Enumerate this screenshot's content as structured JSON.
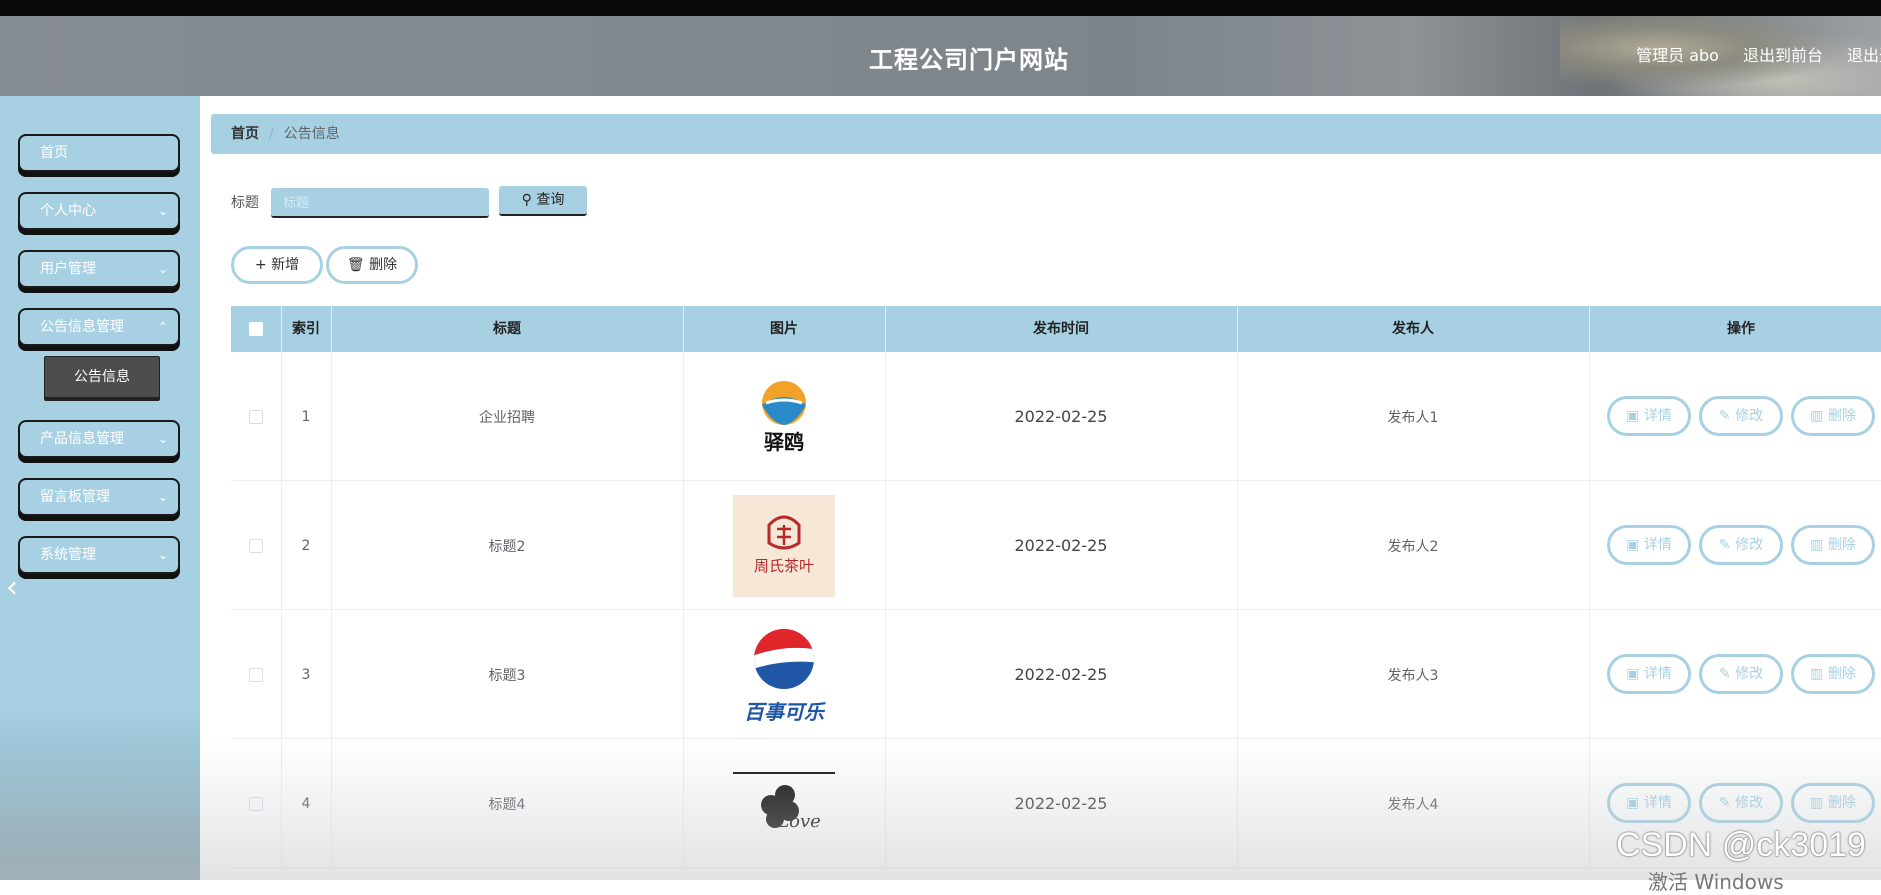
{
  "header": {
    "site_title": "工程公司门户网站",
    "admin_label": "管理员 abo",
    "back_front": "退出到前台",
    "logout": "退出登录"
  },
  "sidebar": {
    "items": [
      {
        "label": "首页",
        "has_children": false
      },
      {
        "label": "个人中心",
        "has_children": true
      },
      {
        "label": "用户管理",
        "has_children": true
      },
      {
        "label": "公告信息管理",
        "has_children": true
      },
      {
        "label": "产品信息管理",
        "has_children": true
      },
      {
        "label": "留言板管理",
        "has_children": true
      },
      {
        "label": "系统管理",
        "has_children": true
      }
    ],
    "active_sub": "公告信息"
  },
  "breadcrumb": {
    "home": "首页",
    "separator": "/",
    "current": "公告信息"
  },
  "search": {
    "label": "标题",
    "placeholder": "标题",
    "button": "查询"
  },
  "actions": {
    "add": "新增",
    "delete": "删除"
  },
  "table": {
    "headers": [
      "索引",
      "标题",
      "图片",
      "发布时间",
      "发布人",
      "操作"
    ],
    "rows": [
      {
        "index": "1",
        "title": "企业招聘",
        "logo_text": "驿鸥",
        "date": "2022-02-25",
        "publisher": "发布人1"
      },
      {
        "index": "2",
        "title": "标题2",
        "logo_text": "周氏茶叶",
        "date": "2022-02-25",
        "publisher": "发布人2"
      },
      {
        "index": "3",
        "title": "标题3",
        "logo_text": "百事可乐",
        "date": "2022-02-25",
        "publisher": "发布人3"
      },
      {
        "index": "4",
        "title": "标题4",
        "logo_text": "Love",
        "date": "2022-02-25",
        "publisher": "发布人4"
      }
    ],
    "row_ops": {
      "detail": "详情",
      "edit": "修改",
      "delete": "删除"
    }
  },
  "watermark": "CSDN @ck3019",
  "windows_activation": "激活 Windows",
  "colors": {
    "accent": "#a7d1e3",
    "header": "#80888e",
    "submenu": "#4d4d4d"
  }
}
